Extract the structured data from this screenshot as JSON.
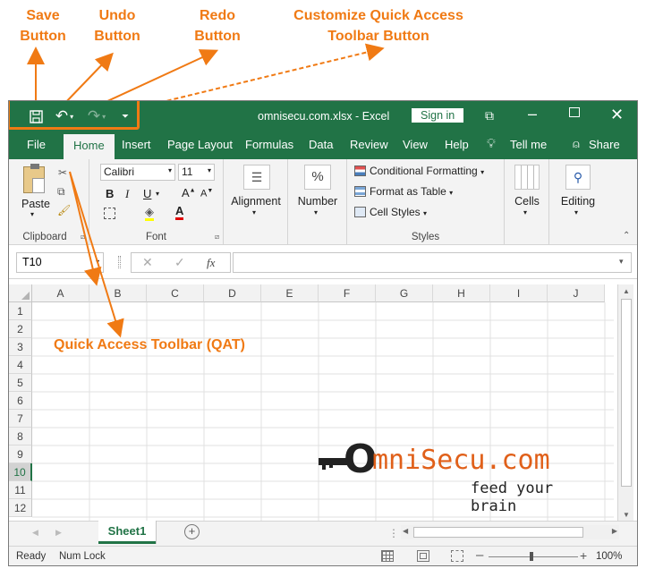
{
  "callouts": {
    "save": "Save\nButton",
    "undo": "Undo\nButton",
    "redo": "Redo\nButton",
    "customize": "Customize Quick Access\nToolbar Button",
    "qat": "Quick Access Toolbar (QAT)"
  },
  "titlebar": {
    "title": "omnisecu.com.xlsx  -  Excel",
    "signin": "Sign in"
  },
  "tabs": [
    "File",
    "Home",
    "Insert",
    "Page Layout",
    "Formulas",
    "Data",
    "Review",
    "View",
    "Help",
    "Tell me",
    "Share"
  ],
  "ribbon": {
    "clipboard": {
      "paste": "Paste",
      "label": "Clipboard"
    },
    "font": {
      "name": "Calibri",
      "size": "11",
      "label": "Font",
      "bold": "B",
      "italic": "I",
      "underline": "U"
    },
    "alignment": "Alignment",
    "number": "Number",
    "styles": {
      "conditional": "Conditional Formatting",
      "format_table": "Format as Table",
      "cell_styles": "Cell Styles",
      "label": "Styles"
    },
    "cells": "Cells",
    "editing": "Editing"
  },
  "formula_bar": {
    "name_box": "T10",
    "fx": "fx",
    "formula": ""
  },
  "columns": [
    "A",
    "B",
    "C",
    "D",
    "E",
    "F",
    "G",
    "H",
    "I",
    "J"
  ],
  "rows": [
    "1",
    "2",
    "3",
    "4",
    "5",
    "6",
    "7",
    "8",
    "9",
    "10",
    "11",
    "12"
  ],
  "selected_row": "10",
  "sheet_tab": "Sheet1",
  "status": {
    "ready": "Ready",
    "numlock": "Num Lock",
    "zoom": "100%"
  },
  "watermark": {
    "brand_o": "O",
    "brand_rest": "mniSecu.com",
    "tagline": "feed your brain"
  },
  "colors": {
    "excel_green": "#217346",
    "callout_orange": "#f07a14"
  }
}
